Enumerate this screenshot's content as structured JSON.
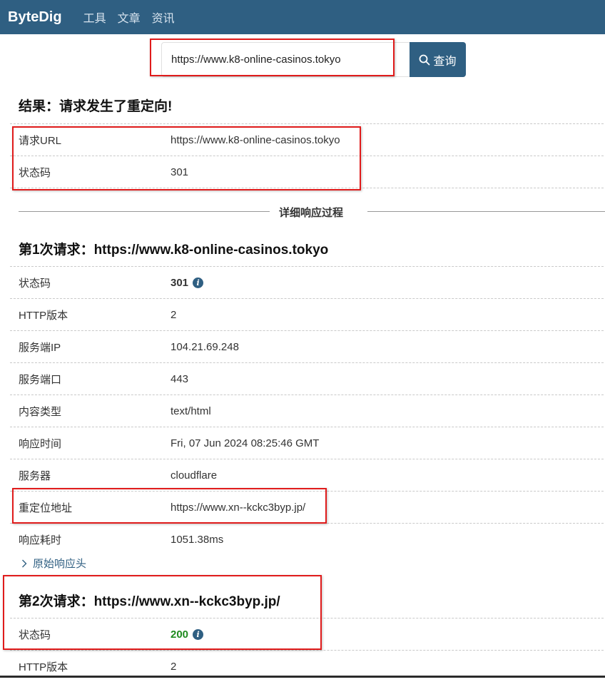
{
  "nav": {
    "brand": "ByteDig",
    "links": [
      "工具",
      "文章",
      "资讯"
    ]
  },
  "search": {
    "value": "https://www.k8-online-casinos.tokyo",
    "button_label": "查询"
  },
  "result": {
    "heading": "结果：请求发生了重定向!",
    "rows": [
      {
        "label": "请求URL",
        "value": "https://www.k8-online-casinos.tokyo"
      },
      {
        "label": "状态码",
        "value": "301"
      }
    ]
  },
  "divider_label": "详细响应过程",
  "requests": [
    {
      "heading": "第1次请求：https://www.k8-online-casinos.tokyo",
      "rows": [
        {
          "label": "状态码",
          "value": "301"
        },
        {
          "label": "HTTP版本",
          "value": "2"
        },
        {
          "label": "服务端IP",
          "value": "104.21.69.248"
        },
        {
          "label": "服务端口",
          "value": "443"
        },
        {
          "label": "内容类型",
          "value": "text/html"
        },
        {
          "label": "响应时间",
          "value": "Fri, 07 Jun 2024 08:25:46 GMT"
        },
        {
          "label": "服务器",
          "value": "cloudflare"
        },
        {
          "label": "重定位地址",
          "value": "https://www.xn--kckc3byp.jp/"
        },
        {
          "label": "响应耗时",
          "value": "1051.38ms"
        }
      ],
      "raw_headers_label": "原始响应头"
    },
    {
      "heading": "第2次请求：https://www.xn--kckc3byp.jp/",
      "rows": [
        {
          "label": "状态码",
          "value": "200"
        },
        {
          "label": "HTTP版本",
          "value": "2"
        }
      ]
    }
  ],
  "colors": {
    "nav_bg": "#2f5f82",
    "highlight_border": "#e01b1b",
    "status_ok": "#1e8a1e"
  }
}
